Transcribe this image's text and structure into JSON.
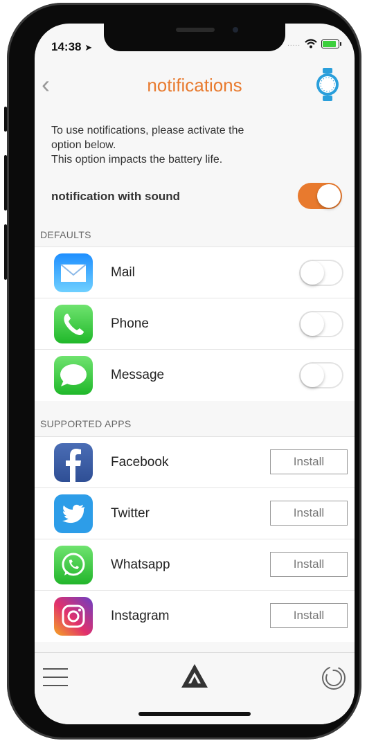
{
  "status": {
    "time": "14:38",
    "signal": "....."
  },
  "header": {
    "title": "notifications"
  },
  "intro": "To use notifications, please activate the\noption below.\nThis option impacts the battery life.",
  "sound": {
    "label": "notification with sound",
    "enabled": true
  },
  "defaults": {
    "header": "DEFAULTS",
    "items": [
      {
        "label": "Mail",
        "icon": "mail-icon",
        "enabled": false
      },
      {
        "label": "Phone",
        "icon": "phone-icon",
        "enabled": false
      },
      {
        "label": "Message",
        "icon": "message-icon",
        "enabled": false
      }
    ]
  },
  "supported": {
    "header": "SUPPORTED APPS",
    "install_label": "Install",
    "items": [
      {
        "label": "Facebook",
        "icon": "facebook-icon"
      },
      {
        "label": "Twitter",
        "icon": "twitter-icon"
      },
      {
        "label": "Whatsapp",
        "icon": "whatsapp-icon"
      },
      {
        "label": "Instagram",
        "icon": "instagram-icon"
      }
    ]
  },
  "colors": {
    "accent": "#e87a2e",
    "watch_blue": "#2a9fdb"
  }
}
